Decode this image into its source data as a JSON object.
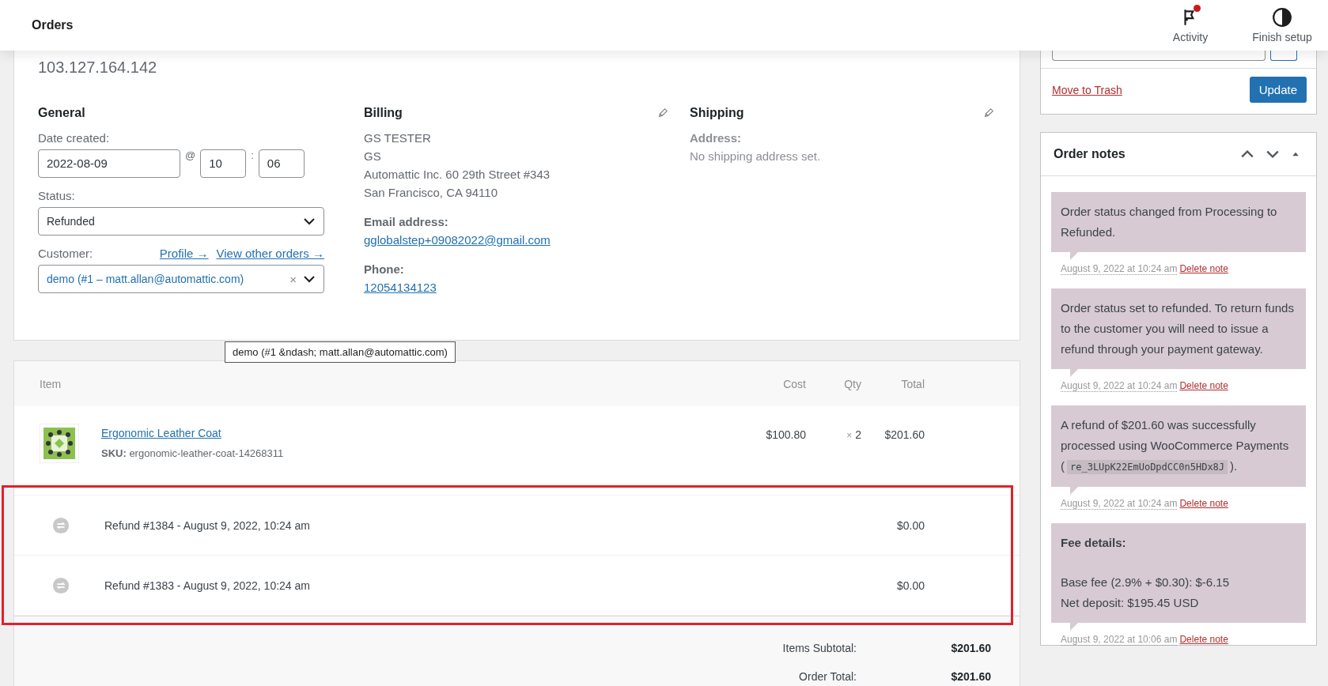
{
  "header": {
    "title": "Orders",
    "actions": [
      {
        "kind": "activity",
        "label": "Activity",
        "badge": true
      },
      {
        "kind": "setup",
        "label": "Finish setup",
        "badge": false
      }
    ]
  },
  "order_data": {
    "customer_ip": "103.127.164.142",
    "general": {
      "title": "General",
      "date_label": "Date created:",
      "date": "2022-08-09",
      "at": "@",
      "hour": "10",
      "colon": ":",
      "minute": "06",
      "status_label": "Status:",
      "status": "Refunded",
      "customer_label": "Customer:",
      "links": [
        "Profile →",
        "View other orders →"
      ],
      "customer": "demo (#1 – matt.allan@automattic.com)",
      "clear": "×",
      "tooltip": "demo (#1 &ndash; matt.allan@automattic.com)"
    },
    "billing": {
      "title": "Billing",
      "address": [
        "GS TESTER",
        "GS",
        "Automattic Inc. 60 29th Street #343",
        "San Francisco, CA 94110"
      ],
      "email_label": "Email address:",
      "email": "gglobalstep+09082022@gmail.com",
      "phone_label": "Phone:",
      "phone": "12054134123"
    },
    "shipping": {
      "title": "Shipping",
      "address_label": "Address:",
      "address": "No shipping address set."
    }
  },
  "items": {
    "columns": [
      "Item",
      "Cost",
      "Qty",
      "Total"
    ],
    "rows": [
      {
        "kind": "product",
        "name": "Ergonomic Leather Coat",
        "sku_label": "SKU:",
        "sku": "ergonomic-leather-coat-14268311",
        "cost": "$100.80",
        "qty_sign": "×",
        "qty": "2",
        "total": "$201.60"
      },
      {
        "kind": "refund",
        "name": "Refund #1384 - August 9, 2022, 10:24 am",
        "total": "$0.00"
      },
      {
        "kind": "refund",
        "name": "Refund #1383 - August 9, 2022, 10:24 am",
        "total": "$0.00"
      }
    ],
    "highlighted_rows": true,
    "totals": [
      {
        "label": "Items Subtotal:",
        "value": "$201.60"
      },
      {
        "label": "Order Total:",
        "value": "$201.60"
      }
    ]
  },
  "sidebar": {
    "trash": "Move to Trash",
    "update": "Update",
    "notes_title": "Order notes",
    "notes": [
      {
        "kind": "plain",
        "text": "Order status changed from Processing to Refunded.",
        "date": "August 9, 2022 at 10:24 am",
        "delete": "Delete note"
      },
      {
        "kind": "plain",
        "text": "Order status set to refunded. To return funds to the customer you will need to issue a refund through your payment gateway.",
        "date": "August 9, 2022 at 10:24 am",
        "delete": "Delete note"
      },
      {
        "kind": "code",
        "text": "A refund of $201.60 was successfully processed using WooCommerce Payments (",
        "code": "re_3LUpK22EmUoDpdCC0n5HDx8J",
        "after": ").",
        "date": "August 9, 2022 at 10:24 am",
        "delete": "Delete note"
      },
      {
        "kind": "fee",
        "heading": "Fee details:",
        "lines": [
          "Base fee (2.9% + $0.30): $-6.15",
          "Net deposit: $195.45 USD"
        ],
        "date": "August 9, 2022 at 10:06 am",
        "delete": "Delete note"
      }
    ]
  }
}
